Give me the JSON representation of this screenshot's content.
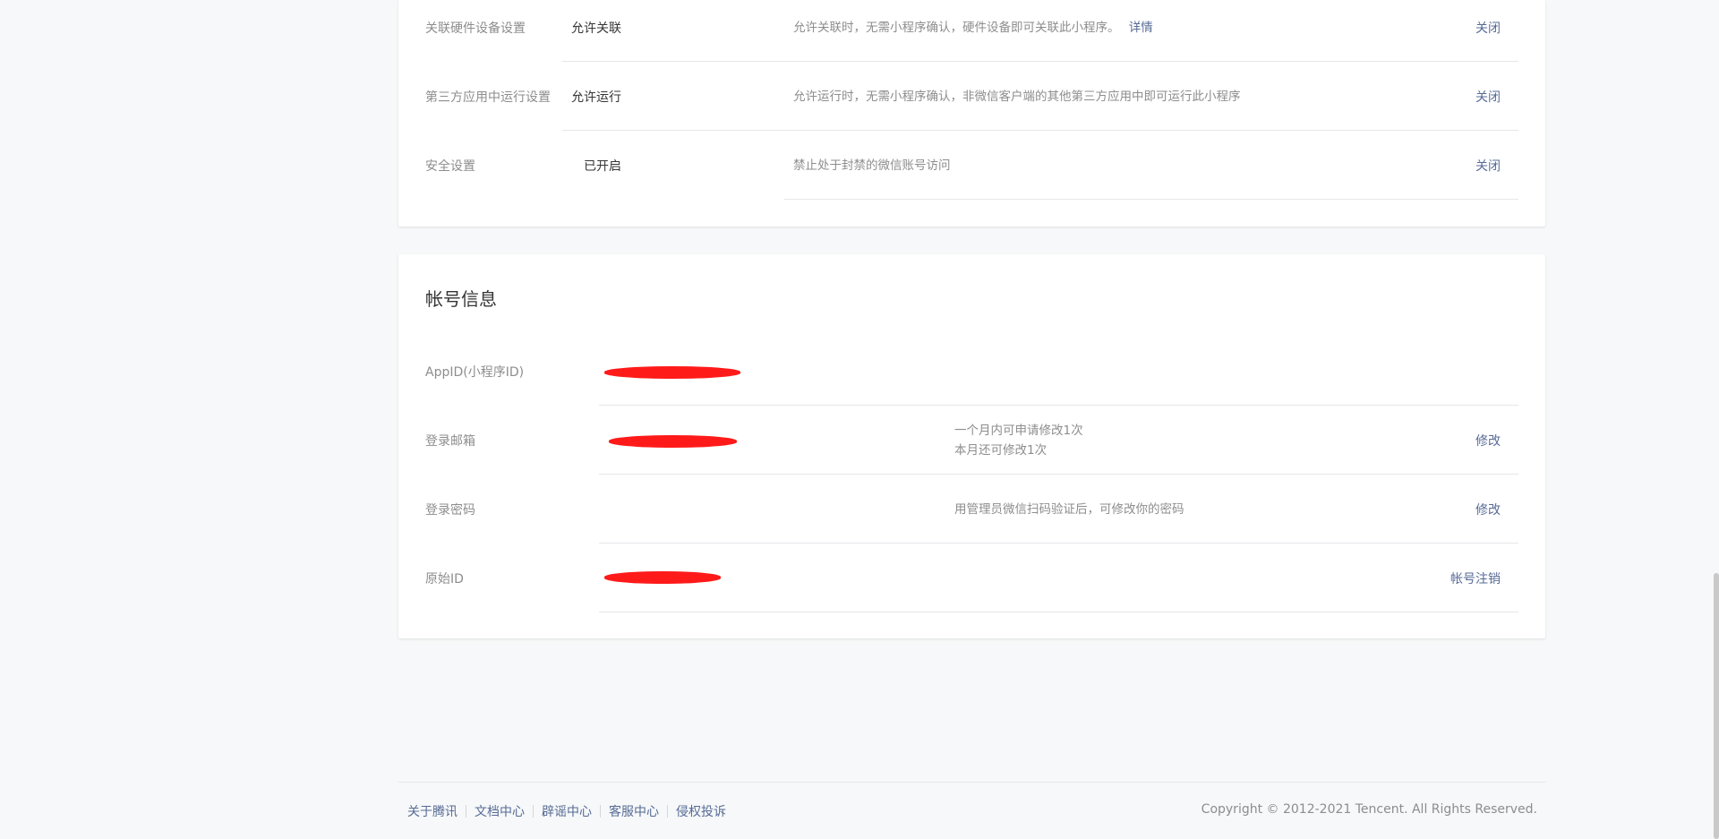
{
  "settings": {
    "rows": [
      {
        "label": "关联硬件设备设置",
        "value": "允许关联",
        "desc": "允许关联时，无需小程序确认，硬件设备即可关联此小程序。",
        "desc_link": "详情",
        "action": "关闭"
      },
      {
        "label": "第三方应用中运行设置",
        "value": "允许运行",
        "desc": "允许运行时，无需小程序确认，非微信客户端的其他第三方应用中即可运行此小程序",
        "action": "关闭"
      },
      {
        "label": "安全设置",
        "value": "已开启",
        "desc": "禁止处于封禁的微信账号访问",
        "action": "关闭"
      }
    ]
  },
  "account": {
    "title": "帐号信息",
    "rows": [
      {
        "label": "AppID(小程序ID)"
      },
      {
        "label": "登录邮箱",
        "desc_line1": "一个月内可申请修改1次",
        "desc_line2": "本月还可修改1次",
        "action": "修改"
      },
      {
        "label": "登录密码",
        "desc": "用管理员微信扫码验证后，可修改你的密码",
        "action": "修改"
      },
      {
        "label": "原始ID",
        "action": "帐号注销"
      }
    ]
  },
  "footer": {
    "links": [
      "关于腾讯",
      "文档中心",
      "辟谣中心",
      "客服中心",
      "侵权投诉"
    ],
    "copyright": "Copyright © 2012-2021 Tencent. All Rights Reserved."
  },
  "colors": {
    "link": "#576b95",
    "background": "#f6f8f9",
    "redaction": "#ff1a1a"
  }
}
